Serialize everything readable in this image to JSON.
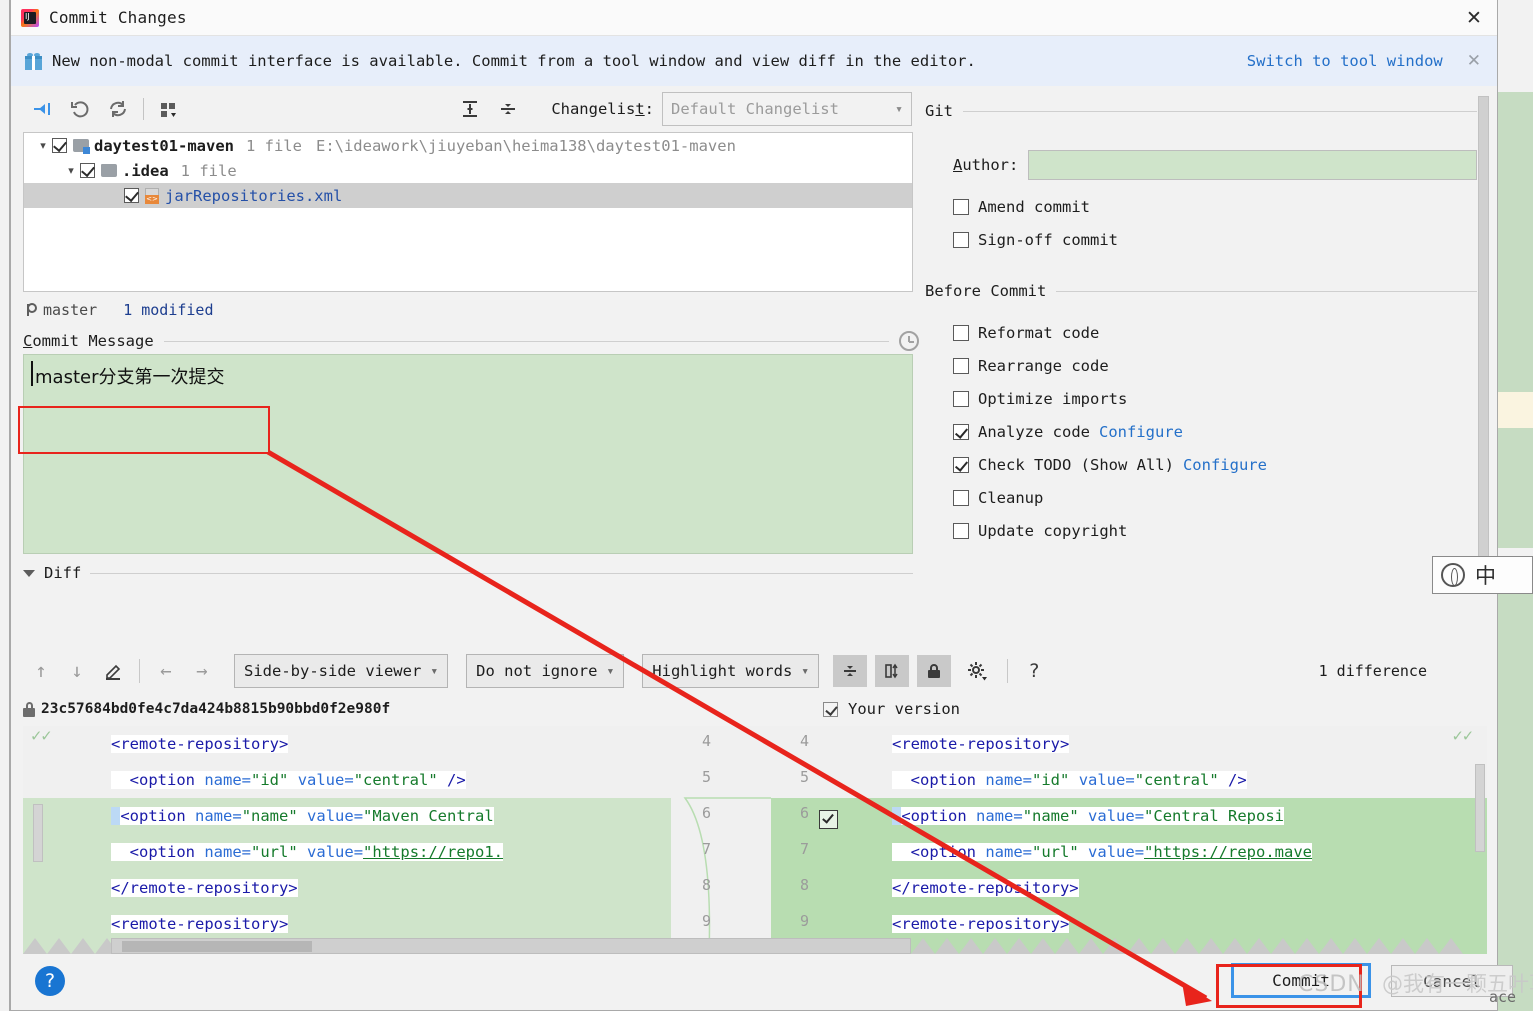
{
  "window": {
    "title": "Commit Changes",
    "app_icon": "intellij-idea-icon",
    "close_icon": "close-icon"
  },
  "banner": {
    "icon": "gift-icon",
    "text": "New non-modal commit interface is available. Commit from a tool window and view diff in the editor.",
    "link": "Switch to tool window",
    "close_icon": "close-icon"
  },
  "changes_toolbar": {
    "icons": [
      "show-diff-icon",
      "revert-icon",
      "refresh-icon",
      "group-by-icon"
    ],
    "expand_icon": "expand-all-icon",
    "collapse_icon": "collapse-all-icon",
    "changelist_label": "Changelist:",
    "changelist_value": "Default Changelist",
    "caret_icon": "chevron-down-icon"
  },
  "tree": {
    "rows": [
      {
        "indent": 0,
        "arrow": "chevron-down-icon",
        "checked": true,
        "icon": "folder-modified-icon",
        "name": "daytest01-maven",
        "meta": "1 file",
        "path": "E:\\ideawork\\jiuyeban\\heima138\\daytest01-maven",
        "selected": false
      },
      {
        "indent": 1,
        "arrow": "chevron-down-icon",
        "checked": true,
        "icon": "folder-icon",
        "name": ".idea",
        "meta": "1 file",
        "path": "",
        "selected": false
      },
      {
        "indent": 2,
        "arrow": "",
        "checked": true,
        "icon": "xml-file-icon",
        "name": "jarRepositories.xml",
        "meta": "",
        "path": "",
        "selected": true
      }
    ]
  },
  "branch": {
    "icon": "git-branch-icon",
    "name": "master",
    "modified": "1 modified"
  },
  "commit_message": {
    "title": "Commit Message",
    "history_icon": "history-clock-icon",
    "value": "master分支第一次提交"
  },
  "git_panel": {
    "section_title": "Git",
    "author_label": "Author:",
    "author_value": "",
    "checkboxes": [
      {
        "label": "Amend commit",
        "checked": false
      },
      {
        "label": "Sign-off commit",
        "checked": false
      }
    ]
  },
  "before_commit": {
    "section_title": "Before Commit",
    "checkboxes": [
      {
        "label": "Reformat code",
        "checked": false,
        "link": ""
      },
      {
        "label": "Rearrange code",
        "checked": false,
        "link": ""
      },
      {
        "label": "Optimize imports",
        "checked": false,
        "link": ""
      },
      {
        "label": "Analyze code",
        "checked": true,
        "link": "Configure"
      },
      {
        "label": "Check TODO (Show All)",
        "checked": true,
        "link": "Configure"
      },
      {
        "label": "Cleanup",
        "checked": false,
        "link": ""
      },
      {
        "label": "Update copyright",
        "checked": false,
        "link": ""
      }
    ]
  },
  "diff": {
    "section_title": "Diff",
    "collapse_icon": "triangle-down-icon",
    "toolbar": {
      "prev_icon": "arrow-up-icon",
      "next_icon": "arrow-down-icon",
      "edit_icon": "pencil-icon",
      "left_icon": "arrow-left-icon",
      "right_icon": "arrow-right-icon",
      "viewer_mode": "Side-by-side viewer",
      "ignore_mode": "Do not ignore",
      "highlight_mode": "Highlight words",
      "collapse_unchanged_icon": "collapse-unchanged-icon",
      "compare_icon": "compare-columns-icon",
      "lock_icon": "lock-icon",
      "settings_icon": "gear-icon",
      "help_icon": "question-mark-icon",
      "difference_count": "1 difference"
    },
    "left_header": {
      "lock_icon": "lock-icon",
      "revision": "23c57684bd0fe4c7da424b8815b90bbd0f2e980f"
    },
    "right_header": {
      "checked": true,
      "label": "Your version"
    },
    "line_numbers": [
      "4",
      "5",
      "6",
      "7",
      "8",
      "9"
    ],
    "left_lines": [
      "<remote-repository>",
      "  <option name=\"id\" value=\"central\" />",
      "  <option name=\"name\" value=\"Maven Central",
      "  <option name=\"url\" value=\"https://repo1.",
      "</remote-repository>",
      "<remote-repository>"
    ],
    "right_lines": [
      "<remote-repository>",
      "  <option name=\"id\" value=\"central\" />",
      "  <option name=\"name\" value=\"Central Reposi",
      "  <option name=\"url\" value=\"https://repo.mave",
      "</remote-repository>",
      "<remote-repository>"
    ],
    "accept_icon": "accept-change-icon",
    "changed_line_index": 2
  },
  "bottom": {
    "help_icon": "question-mark-icon",
    "commit_label": "Commit",
    "cancel_label": "Cancel"
  },
  "ime": {
    "globe_icon": "ime-globe-icon",
    "mode": "中"
  },
  "watermark": {
    "brand": "CSDN",
    "user": "@我有一颗五叶草",
    "edge": "ace"
  },
  "annotations": {
    "highlight_color": "#e8241c",
    "arrow_from": "commit-message-box",
    "arrow_to": "commit-button"
  },
  "colors": {
    "accent_blue": "#2470c9",
    "selection_gray": "#cfcfcf",
    "diff_green": "#cfe4ca",
    "banner_bg": "#e7eefa",
    "annotation_red": "#e8241c"
  }
}
